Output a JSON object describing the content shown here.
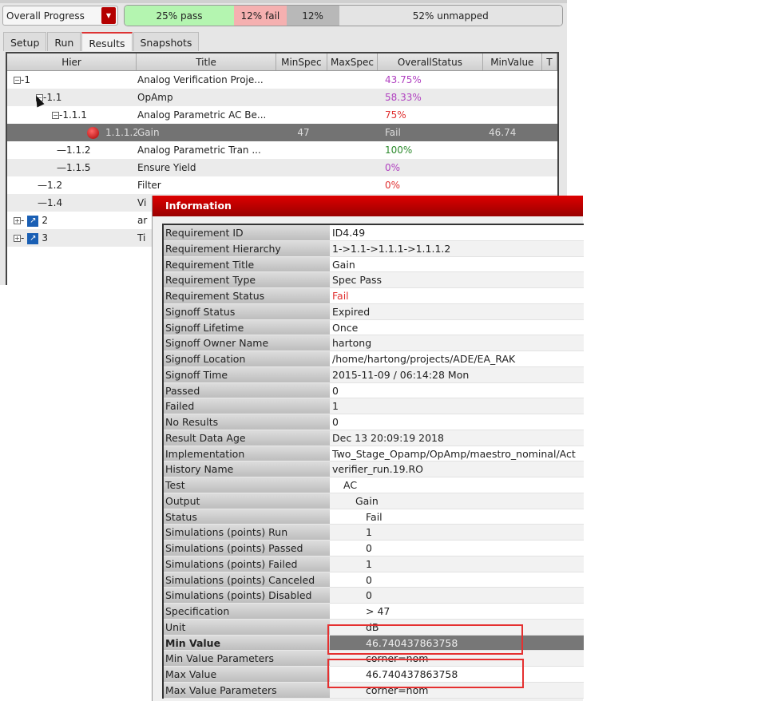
{
  "toolbar": {
    "progress_select": "Overall Progress"
  },
  "progress": [
    {
      "label": "25% pass",
      "percent": 25,
      "color": "#b4f5b0"
    },
    {
      "label": "12% fail",
      "percent": 12,
      "color": "#f5b0b0"
    },
    {
      "label": "12%",
      "percent": 12,
      "color": "#b8b8b8"
    },
    {
      "label": "52% unmapped",
      "percent": 51,
      "color": "#e4e4e4"
    }
  ],
  "tabs": [
    "Setup",
    "Run",
    "Results",
    "Snapshots"
  ],
  "active_tab": "Results",
  "table": {
    "columns": [
      "Hier",
      "Title",
      "MinSpec",
      "MaxSpec",
      "OverallStatus",
      "MinValue",
      "T"
    ],
    "rows": [
      {
        "hier": "1",
        "title": "Analog Verification Proje...",
        "minspec": "",
        "status": "43.75%",
        "status_color": "#b040c0",
        "minvalue": ""
      },
      {
        "hier": "1.1",
        "title": "OpAmp",
        "minspec": "",
        "status": "58.33%",
        "status_color": "#b040c0",
        "minvalue": ""
      },
      {
        "hier": "1.1.1",
        "title": "Analog Parametric AC Be...",
        "minspec": "",
        "status": "75%",
        "status_color": "#e03030",
        "minvalue": ""
      },
      {
        "hier": "1.1.1.2",
        "title": "Gain",
        "minspec": "47",
        "status": "Fail",
        "status_color": "#dddddd",
        "minvalue": "46.74"
      },
      {
        "hier": "1.1.2",
        "title": "Analog Parametric Tran ...",
        "minspec": "",
        "status": "100%",
        "status_color": "#2e8b2e",
        "minvalue": ""
      },
      {
        "hier": "1.1.5",
        "title": "Ensure Yield",
        "minspec": "",
        "status": "0%",
        "status_color": "#b040c0",
        "minvalue": ""
      },
      {
        "hier": "1.2",
        "title": "Filter",
        "minspec": "",
        "status": "0%",
        "status_color": "#e03030",
        "minvalue": ""
      },
      {
        "hier": "1.4",
        "title": "Vi",
        "minspec": "",
        "status": "",
        "status_color": "#222",
        "minvalue": ""
      },
      {
        "hier": "2",
        "title": "ar",
        "minspec": "",
        "status": "",
        "status_color": "#222",
        "minvalue": ""
      },
      {
        "hier": "3",
        "title": "Ti",
        "minspec": "",
        "status": "",
        "status_color": "#222",
        "minvalue": ""
      }
    ]
  },
  "dialog": {
    "title": "Information",
    "rows": [
      {
        "label": "Requirement ID",
        "value": "ID4.49"
      },
      {
        "label": "Requirement Hierarchy",
        "value": "1->1.1->1.1.1->1.1.1.2"
      },
      {
        "label": "Requirement Title",
        "value": "Gain"
      },
      {
        "label": "Requirement Type",
        "value": "Spec Pass"
      },
      {
        "label": "Requirement Status",
        "value": "Fail"
      },
      {
        "label": "Signoff Status",
        "value": "Expired"
      },
      {
        "label": "Signoff Lifetime",
        "value": "Once"
      },
      {
        "label": "Signoff Owner Name",
        "value": "hartong"
      },
      {
        "label": "Signoff Location",
        "value": "/home/hartong/projects/ADE/EA_RAK"
      },
      {
        "label": "Signoff Time",
        "value": "2015-11-09 / 06:14:28 Mon"
      },
      {
        "label": "Passed",
        "value": "0"
      },
      {
        "label": "Failed",
        "value": "1"
      },
      {
        "label": "No Results",
        "value": "0"
      },
      {
        "label": "Result Data Age",
        "value": "Dec 13 20:09:19 2018"
      },
      {
        "label": "Implementation",
        "value": "Two_Stage_Opamp/OpAmp/maestro_nominal/Act"
      },
      {
        "label": "History Name",
        "value": "verifier_run.19.RO"
      },
      {
        "label": "Test",
        "value": "AC"
      },
      {
        "label": "Output",
        "value": "Gain"
      },
      {
        "label": "Status",
        "value": "Fail"
      },
      {
        "label": "Simulations (points) Run",
        "value": "1"
      },
      {
        "label": "Simulations (points) Passed",
        "value": "0"
      },
      {
        "label": "Simulations (points) Failed",
        "value": "1"
      },
      {
        "label": "Simulations (points) Canceled",
        "value": "0"
      },
      {
        "label": "Simulations (points) Disabled",
        "value": "0"
      },
      {
        "label": "Specification",
        "value": "> 47"
      },
      {
        "label": "Unit",
        "value": "dB"
      },
      {
        "label": "Min Value",
        "value": "46.740437863758"
      },
      {
        "label": "Min Value Parameters",
        "value": "corner=nom"
      },
      {
        "label": "Max Value",
        "value": "46.740437863758"
      },
      {
        "label": "Max Value Parameters",
        "value": "corner=nom"
      }
    ]
  }
}
